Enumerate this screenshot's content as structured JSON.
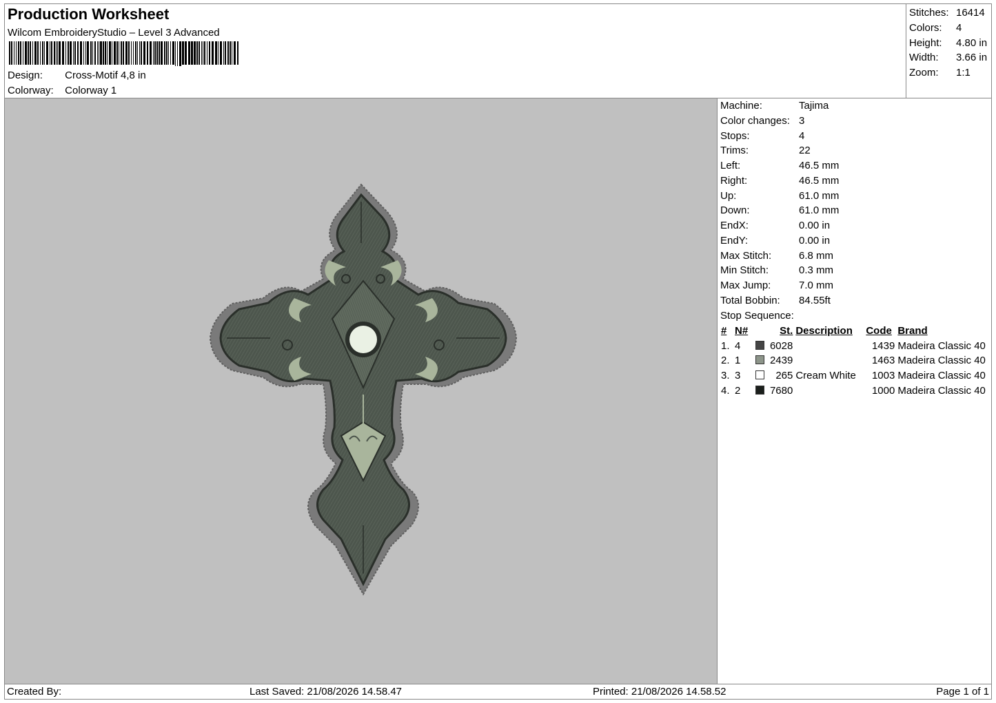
{
  "header": {
    "title": "Production Worksheet",
    "software": "Wilcom EmbroideryStudio – Level 3 Advanced",
    "design_label": "Design:",
    "design_value": "Cross-Motif 4,8 in",
    "colorway_label": "Colorway:",
    "colorway_value": "Colorway 1"
  },
  "stats": [
    {
      "label": "Stitches:",
      "value": "16414"
    },
    {
      "label": "Colors:",
      "value": "4"
    },
    {
      "label": "Height:",
      "value": "4.80 in"
    },
    {
      "label": "Width:",
      "value": "3.66 in"
    },
    {
      "label": "Zoom:",
      "value": "1:1"
    }
  ],
  "info": [
    {
      "label": "Machine:",
      "value": "Tajima"
    },
    {
      "label": "Color changes:",
      "value": "3"
    },
    {
      "label": "Stops:",
      "value": "4"
    },
    {
      "label": "Trims:",
      "value": "22"
    },
    {
      "label": "Left:",
      "value": "46.5 mm"
    },
    {
      "label": "Right:",
      "value": "46.5 mm"
    },
    {
      "label": "Up:",
      "value": "61.0 mm"
    },
    {
      "label": "Down:",
      "value": "61.0 mm"
    },
    {
      "label": "EndX:",
      "value": "0.00 in"
    },
    {
      "label": "EndY:",
      "value": "0.00 in"
    },
    {
      "label": "Max Stitch:",
      "value": "6.8 mm"
    },
    {
      "label": "Min Stitch:",
      "value": "0.3 mm"
    },
    {
      "label": "Max Jump:",
      "value": "7.0 mm"
    },
    {
      "label": "Total Bobbin:",
      "value": "84.55ft"
    },
    {
      "label": "Stop Sequence:",
      "value": ""
    }
  ],
  "sequence": {
    "headers": [
      "#",
      "N#",
      "St.",
      "Description",
      "Code",
      "Brand"
    ],
    "rows": [
      {
        "idx": "1.",
        "n": "4",
        "color": "#454545",
        "st": "6028",
        "desc": "",
        "code": "1439",
        "brand": "Madeira Classic 40"
      },
      {
        "idx": "2.",
        "n": "1",
        "color": "#8d958a",
        "st": "2439",
        "desc": "",
        "code": "1463",
        "brand": "Madeira Classic 40"
      },
      {
        "idx": "3.",
        "n": "3",
        "color": "#ffffff",
        "st": "265",
        "desc": "Cream White",
        "code": "1003",
        "brand": "Madeira Classic 40"
      },
      {
        "idx": "4.",
        "n": "2",
        "color": "#1b1f1c",
        "st": "7680",
        "desc": "",
        "code": "1000",
        "brand": "Madeira Classic 40"
      }
    ]
  },
  "footer": {
    "created_by": "Created By:",
    "last_saved": "Last Saved: 21/08/2026 14.58.47",
    "printed": "Printed: 21/08/2026 14.58.52",
    "page": "Page 1 of 1"
  },
  "colors": {
    "canvas_bg": "#c0c0c0",
    "outline_gray": "#7a7a7a",
    "fill_dark": "#4d564d",
    "fill_light": "#a9b59c",
    "center": "#eaf1e4"
  }
}
